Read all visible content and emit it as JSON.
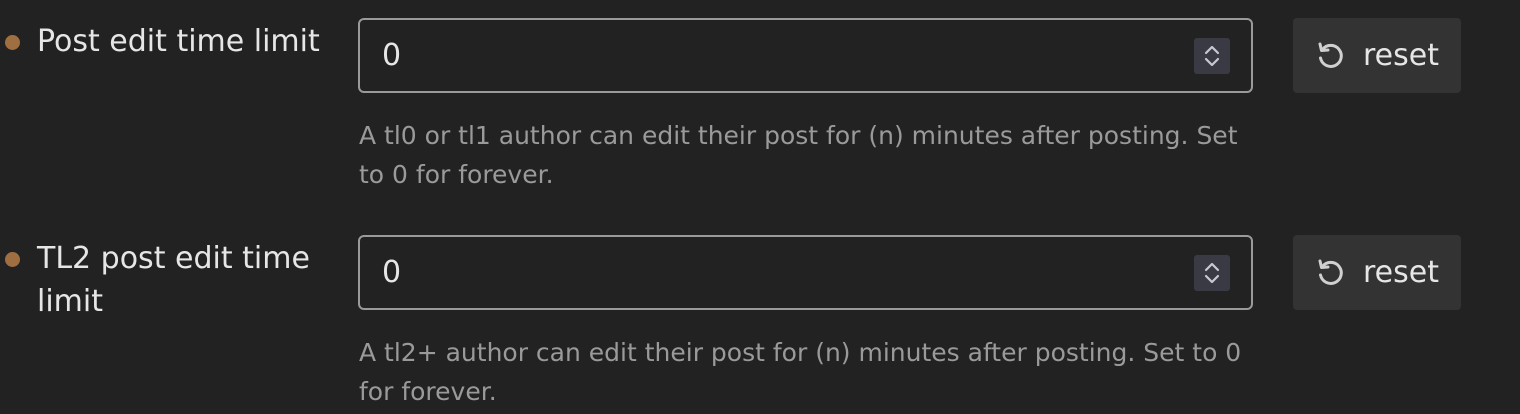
{
  "settings": [
    {
      "label": "Post edit time limit",
      "value": "0",
      "reset_label": "reset",
      "description": "A tl0 or tl1 author can edit their post for (n) minutes after posting. Set to 0 for forever."
    },
    {
      "label": "TL2 post edit time limit",
      "value": "0",
      "reset_label": "reset",
      "description": "A tl2+ author can edit their post for (n) minutes after posting. Set to 0 for forever."
    }
  ],
  "colors": {
    "background": "#222222",
    "modified_indicator": "#a06f41",
    "input_border": "#9a9a9a",
    "button_bg": "#333333",
    "description_text": "#9a9a9a"
  },
  "icons": {
    "reset": "undo-icon",
    "spinner": "chevron-up-down-icon",
    "modified": "dot-icon"
  }
}
